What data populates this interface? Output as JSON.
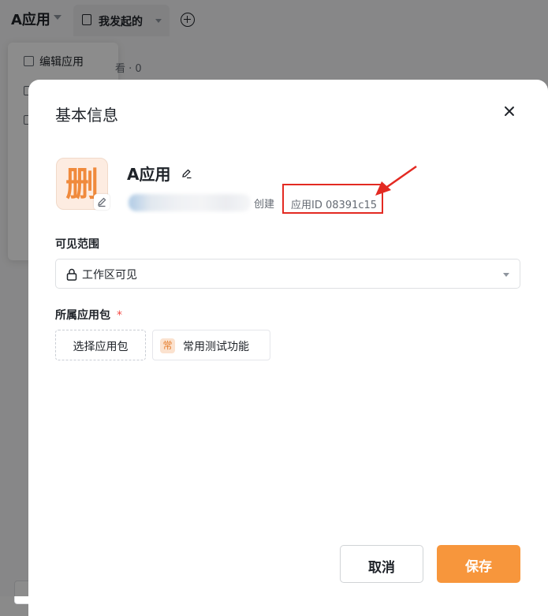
{
  "background": {
    "app_title": "A应用",
    "tab_label": "我发起的",
    "menu_first_item": "编辑应用",
    "meta_text": "看 · 0"
  },
  "modal": {
    "title": "基本信息",
    "app": {
      "icon_char": "删",
      "name": "A应用",
      "created_label": "创建",
      "app_id": "应用ID 08391c15"
    },
    "visibility": {
      "label": "可见范围",
      "value": "工作区可见"
    },
    "package": {
      "label": "所属应用包",
      "required_mark": "*",
      "select_button": "选择应用包",
      "tag_icon": "常",
      "tag_label": "常用测试功能"
    },
    "footer": {
      "cancel": "取消",
      "save": "保存"
    }
  },
  "colors": {
    "accent": "#f7963c",
    "annotation_red": "#e32a22"
  }
}
